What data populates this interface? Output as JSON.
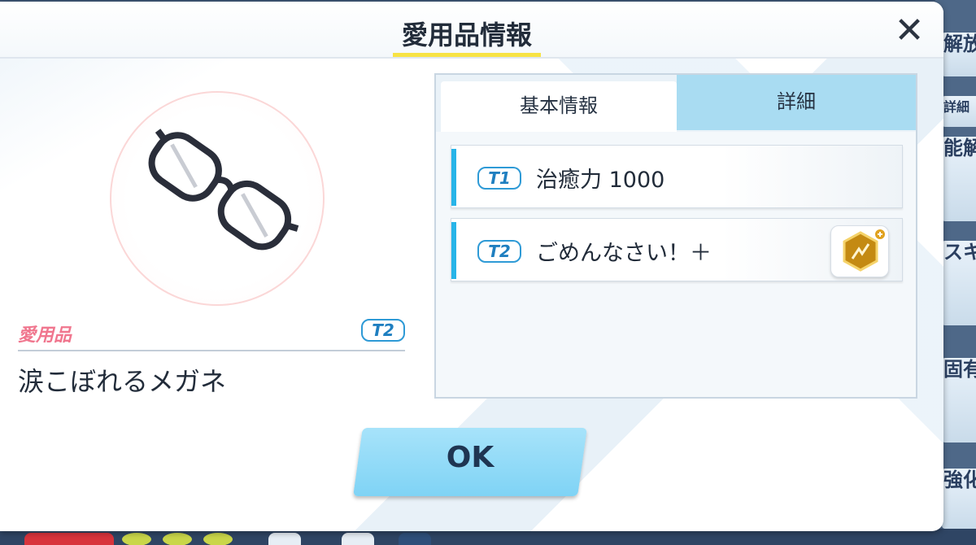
{
  "header": {
    "title": "愛用品情報",
    "close_label": "✕"
  },
  "item": {
    "category_label": "愛用品",
    "tier": "T2",
    "name": "涙こぼれるメガネ"
  },
  "tabs": [
    {
      "label": "基本情報",
      "active": true
    },
    {
      "label": "詳細",
      "active": false
    }
  ],
  "effects": [
    {
      "tier": "T1",
      "text": "治癒力 1000"
    },
    {
      "tier": "T2",
      "text": "ごめんなさい！＋"
    }
  ],
  "ok_button": {
    "label": "OK"
  },
  "side_menu": {
    "items": [
      "解放",
      "詳細",
      "能解",
      "スキ成長",
      "固有武器",
      "強化"
    ]
  },
  "colors": {
    "title_underline": "#f7e344",
    "accent_blue": "#27b4e8",
    "tab_inactive": "#a9dcf2",
    "ok_button": "#8fd9f7",
    "category_pink": "#f0768e"
  }
}
